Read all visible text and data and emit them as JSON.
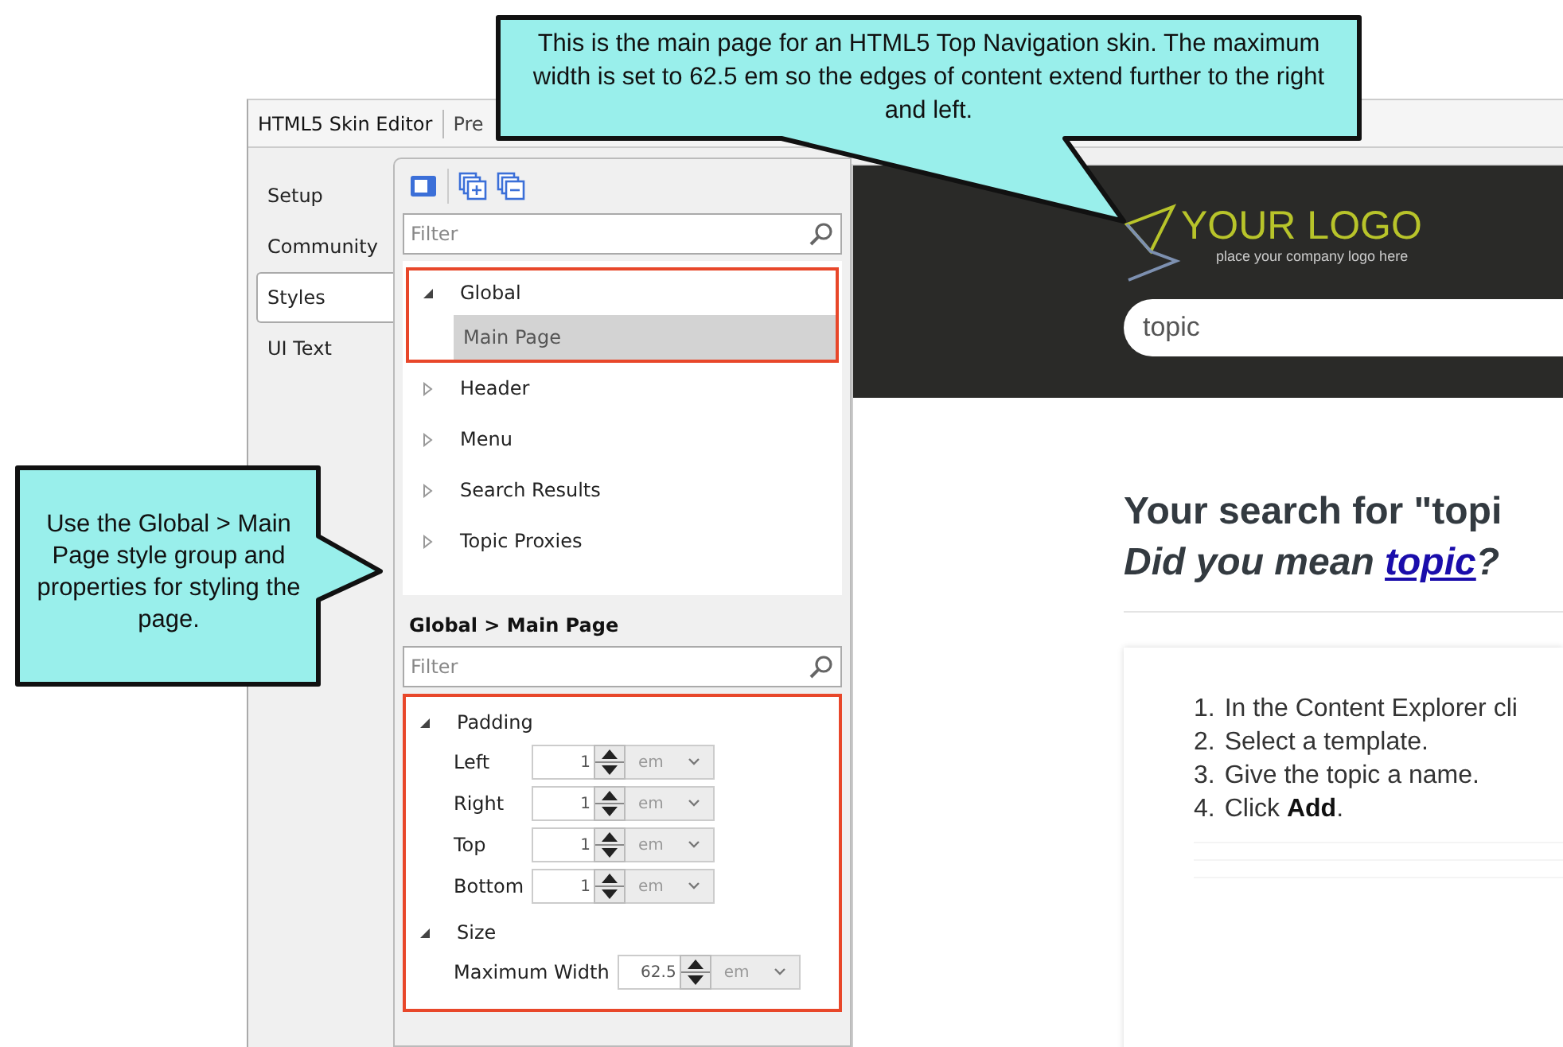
{
  "window_tabs": [
    {
      "label": "HTML5 Skin Editor",
      "selected": true
    },
    {
      "label": "Pre",
      "selected": false
    }
  ],
  "side_tabs": [
    {
      "label": "Setup",
      "selected": false
    },
    {
      "label": "Community",
      "selected": false
    },
    {
      "label": "Styles",
      "selected": true
    },
    {
      "label": "UI Text",
      "selected": false
    }
  ],
  "style_filter": {
    "placeholder": "Filter"
  },
  "style_tree": [
    {
      "label": "Global",
      "expanded": true,
      "outlined": true,
      "selected": false,
      "children": [
        {
          "label": "Main Page",
          "selected": true
        }
      ]
    },
    {
      "label": "Header",
      "expanded": false,
      "outlined": false,
      "selected": false
    },
    {
      "label": "Menu",
      "expanded": false,
      "outlined": false,
      "selected": false
    },
    {
      "label": "Search Results",
      "expanded": false,
      "outlined": false,
      "selected": false
    },
    {
      "label": "Topic Proxies",
      "expanded": false,
      "outlined": false,
      "selected": false
    }
  ],
  "properties": {
    "title": "Global > Main Page",
    "filter": {
      "placeholder": "Filter"
    },
    "outlined": true,
    "groups": [
      {
        "label": "Padding",
        "expanded": true,
        "fields": [
          {
            "label": "Left",
            "value": "1",
            "unit": "em"
          },
          {
            "label": "Right",
            "value": "1",
            "unit": "em"
          },
          {
            "label": "Top",
            "value": "1",
            "unit": "em"
          },
          {
            "label": "Bottom",
            "value": "1",
            "unit": "em"
          }
        ]
      },
      {
        "label": "Size",
        "expanded": true,
        "fields": [
          {
            "label": "Maximum Width",
            "value": "62.5",
            "unit": "em"
          }
        ]
      }
    ]
  },
  "preview": {
    "logo": {
      "title": "YOUR LOGO",
      "tagline": "place your company logo here"
    },
    "search": {
      "value": "topic"
    },
    "heading": "Your search for \"topi",
    "suggestion": {
      "prefix": "Did you mean ",
      "link": "topic",
      "suffix": "?"
    },
    "steps": [
      {
        "number": "1.",
        "text": "In the Content Explorer cli"
      },
      {
        "number": "2.",
        "text": "Select a template."
      },
      {
        "number": "3.",
        "text": "Give the topic a name."
      },
      {
        "number": "4.",
        "text": "Click **Add**."
      }
    ]
  },
  "callouts": [
    {
      "text": "This is the main page for an HTML5 Top Navigation skin. The maximum width is set to 62.5 em so the edges of content extend further to the right and left."
    },
    {
      "text": "Use the Global > Main Page style group and properties for styling the page."
    }
  ]
}
